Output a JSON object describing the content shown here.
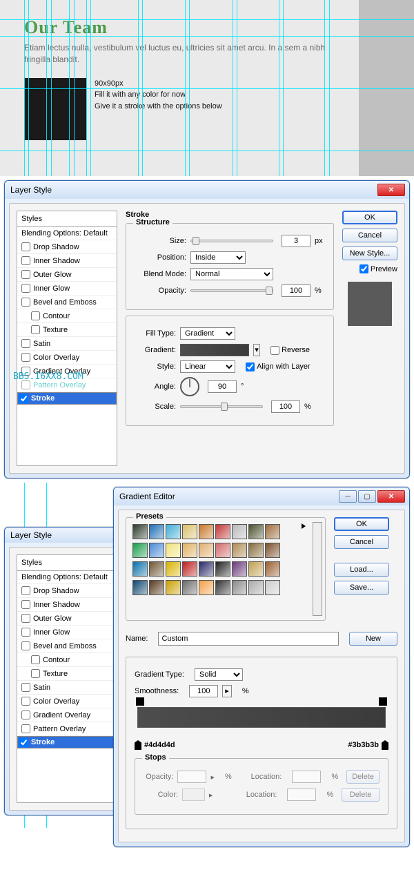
{
  "top": {
    "title": "Our Team",
    "lorem": "Etiam lectus nulla, vestibulum vel luctus eu, ultricies sit amet arcu. In a sem a nibh fringilla blandit.",
    "sq_note1": "90x90px",
    "sq_note2": "Fill it with any color for now",
    "sq_note3": "Give it a stroke with the options below"
  },
  "watermark": "BBS.16XX8.COM",
  "layer_style": {
    "title": "Layer Style",
    "styles_header": "Styles",
    "blending": "Blending Options: Default",
    "effects": [
      "Drop Shadow",
      "Inner Shadow",
      "Outer Glow",
      "Inner Glow",
      "Bevel and Emboss",
      "Contour",
      "Texture",
      "Satin",
      "Color Overlay",
      "Gradient Overlay",
      "Pattern Overlay",
      "Stroke"
    ],
    "ok": "OK",
    "cancel": "Cancel",
    "newstyle": "New Style...",
    "preview": "Preview"
  },
  "stroke": {
    "heading": "Stroke",
    "structure": "Structure",
    "size_l": "Size:",
    "size_v": "3",
    "size_u": "px",
    "position_l": "Position:",
    "position_v": "Inside",
    "blend_l": "Blend Mode:",
    "blend_v": "Normal",
    "opacity_l": "Opacity:",
    "opacity_v": "100",
    "pct": "%",
    "filltype_l": "Fill Type:",
    "filltype_v": "Gradient",
    "gradient_l": "Gradient:",
    "reverse": "Reverse",
    "style_l": "Style:",
    "style_v": "Linear",
    "align": "Align with Layer",
    "angle_l": "Angle:",
    "angle_v": "90",
    "deg": "°",
    "scale_l": "Scale:",
    "scale_v": "100"
  },
  "ge": {
    "title": "Gradient Editor",
    "presets": "Presets",
    "ok": "OK",
    "cancel": "Cancel",
    "load": "Load...",
    "save": "Save...",
    "name_l": "Name:",
    "name_v": "Custom",
    "new": "New",
    "gtype_l": "Gradient Type:",
    "gtype_v": "Solid",
    "smooth_l": "Smoothness:",
    "smooth_v": "100",
    "pct": "%",
    "hex1": "#4d4d4d",
    "hex2": "#3b3b3b",
    "stops": "Stops",
    "opacity_l": "Opacity:",
    "location_l": "Location:",
    "color_l": "Color:",
    "delete": "Delete"
  },
  "preset_colors": [
    [
      "#2b3a2b",
      "#1f6fb5",
      "#42acd6",
      "#d8c06a",
      "#c9782a",
      "#c13838",
      "#b9b9b9",
      "#4a522e",
      "#9d6b3b"
    ],
    [
      "#1a9e4b",
      "#4b88d6",
      "#f0e37a",
      "#e0b060",
      "#e2b070",
      "#d16a6a",
      "#ae8a52",
      "#856a3a",
      "#7a4f2b"
    ],
    [
      "#0a6fa8",
      "#705735",
      "#d7b200",
      "#bd2020",
      "#2b2b6a",
      "#222",
      "#6a3a7a",
      "#c0a050",
      "#995f30"
    ],
    [
      "#0f4870",
      "#563a1e",
      "#c8a000",
      "#6b6b6b",
      "#f4a24a",
      "#333",
      "#888",
      "#aaa",
      "#ccc"
    ]
  ]
}
